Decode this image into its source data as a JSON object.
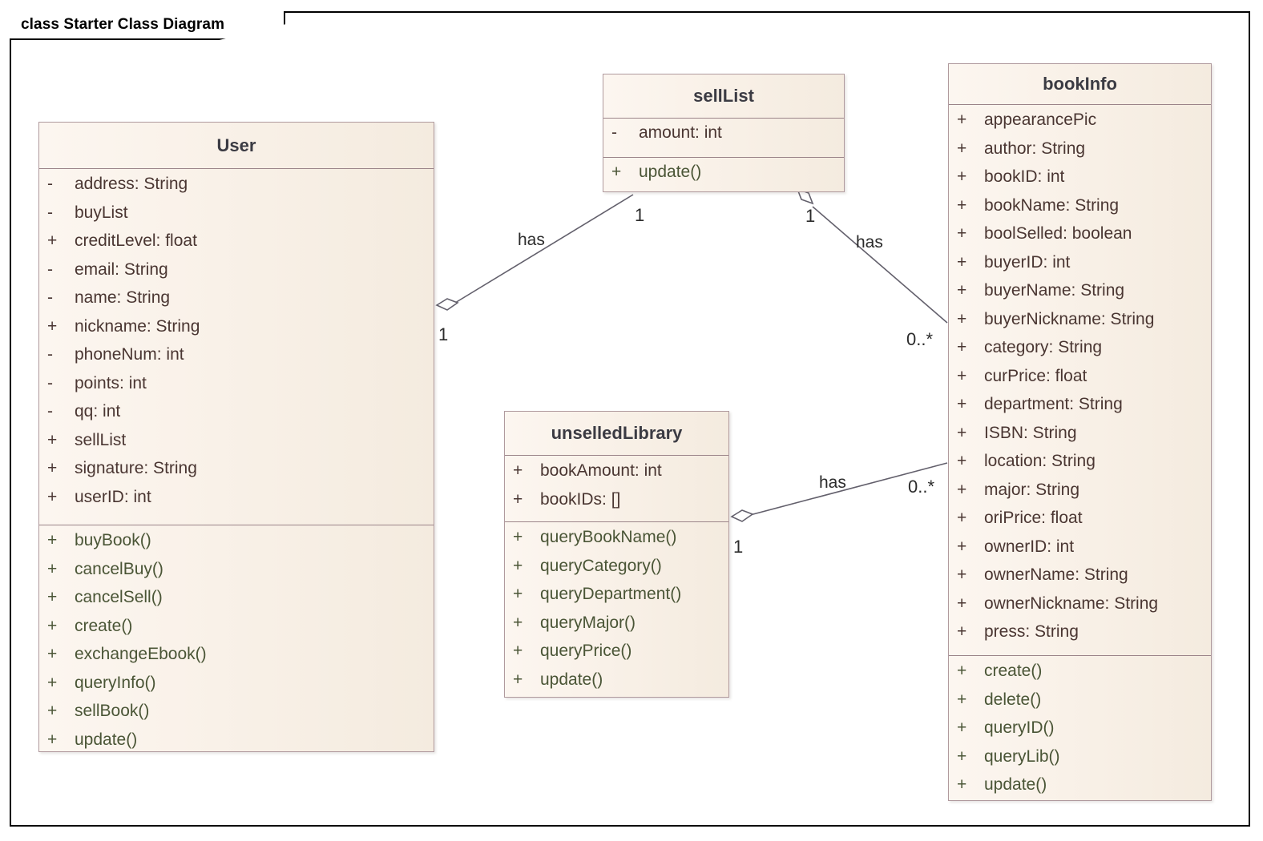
{
  "diagram": {
    "title": "class Starter Class Diagram",
    "frame_border_color": "#000000",
    "box_fill_color": "#f9f1e8",
    "box_border_color": "#b09a9e",
    "attribute_text_color": "#4a3632",
    "method_text_color": "#4a5536",
    "connector_color": "#63606c",
    "type": "uml-class-diagram"
  },
  "classes": [
    {
      "id": "user",
      "name": "User",
      "attributes": [
        {
          "visibility": "-",
          "label": "address: String"
        },
        {
          "visibility": "-",
          "label": "buyList"
        },
        {
          "visibility": "+",
          "label": "creditLevel: float"
        },
        {
          "visibility": "-",
          "label": "email: String"
        },
        {
          "visibility": "-",
          "label": "name: String"
        },
        {
          "visibility": "+",
          "label": "nickname: String"
        },
        {
          "visibility": "-",
          "label": "phoneNum: int"
        },
        {
          "visibility": "-",
          "label": "points: int"
        },
        {
          "visibility": "-",
          "label": "qq: int"
        },
        {
          "visibility": "+",
          "label": "sellList"
        },
        {
          "visibility": "+",
          "label": "signature: String"
        },
        {
          "visibility": "+",
          "label": "userID: int"
        }
      ],
      "methods": [
        {
          "visibility": "+",
          "label": "buyBook()"
        },
        {
          "visibility": "+",
          "label": "cancelBuy()"
        },
        {
          "visibility": "+",
          "label": "cancelSell()"
        },
        {
          "visibility": "+",
          "label": "create()"
        },
        {
          "visibility": "+",
          "label": "exchangeEbook()"
        },
        {
          "visibility": "+",
          "label": "queryInfo()"
        },
        {
          "visibility": "+",
          "label": "sellBook()"
        },
        {
          "visibility": "+",
          "label": "update()"
        }
      ]
    },
    {
      "id": "selllist",
      "name": "sellList",
      "attributes": [
        {
          "visibility": "-",
          "label": "amount: int"
        }
      ],
      "methods": [
        {
          "visibility": "+",
          "label": "update()"
        }
      ]
    },
    {
      "id": "unselledlibrary",
      "name": "unselledLibrary",
      "attributes": [
        {
          "visibility": "+",
          "label": "bookAmount: int"
        },
        {
          "visibility": "+",
          "label": "bookIDs: []"
        }
      ],
      "methods": [
        {
          "visibility": "+",
          "label": "queryBookName()"
        },
        {
          "visibility": "+",
          "label": "queryCategory()"
        },
        {
          "visibility": "+",
          "label": "queryDepartment()"
        },
        {
          "visibility": "+",
          "label": "queryMajor()"
        },
        {
          "visibility": "+",
          "label": "queryPrice()"
        },
        {
          "visibility": "+",
          "label": "update()"
        }
      ]
    },
    {
      "id": "bookinfo",
      "name": "bookInfo",
      "attributes": [
        {
          "visibility": "+",
          "label": "appearancePic"
        },
        {
          "visibility": "+",
          "label": "author: String"
        },
        {
          "visibility": "+",
          "label": "bookID: int"
        },
        {
          "visibility": "+",
          "label": "bookName: String"
        },
        {
          "visibility": "+",
          "label": "boolSelled: boolean"
        },
        {
          "visibility": "+",
          "label": "buyerID: int"
        },
        {
          "visibility": "+",
          "label": "buyerName: String"
        },
        {
          "visibility": "+",
          "label": "buyerNickname: String"
        },
        {
          "visibility": "+",
          "label": "category: String"
        },
        {
          "visibility": "+",
          "label": "curPrice: float"
        },
        {
          "visibility": "+",
          "label": "department: String"
        },
        {
          "visibility": "+",
          "label": "ISBN: String"
        },
        {
          "visibility": "+",
          "label": "location: String"
        },
        {
          "visibility": "+",
          "label": "major: String"
        },
        {
          "visibility": "+",
          "label": "oriPrice: float"
        },
        {
          "visibility": "+",
          "label": "ownerID: int"
        },
        {
          "visibility": "+",
          "label": "ownerName: String"
        },
        {
          "visibility": "+",
          "label": "ownerNickname: String"
        },
        {
          "visibility": "+",
          "label": "press: String"
        }
      ],
      "methods": [
        {
          "visibility": "+",
          "label": "create()"
        },
        {
          "visibility": "+",
          "label": "delete()"
        },
        {
          "visibility": "+",
          "label": "queryID()"
        },
        {
          "visibility": "+",
          "label": "queryLib()"
        },
        {
          "visibility": "+",
          "label": "update()"
        }
      ]
    }
  ],
  "associations": [
    {
      "id": "user-selllist",
      "from": "User",
      "to": "sellList",
      "label": "has",
      "from_multiplicity": "1",
      "to_multiplicity": "1",
      "kind": "aggregation"
    },
    {
      "id": "selllist-bookinfo",
      "from": "sellList",
      "to": "bookInfo",
      "label": "has",
      "from_multiplicity": "1",
      "to_multiplicity": "0..*",
      "kind": "aggregation"
    },
    {
      "id": "unselledlibrary-bookinfo",
      "from": "unselledLibrary",
      "to": "bookInfo",
      "label": "has",
      "from_multiplicity": "1",
      "to_multiplicity": "0..*",
      "kind": "aggregation"
    }
  ]
}
